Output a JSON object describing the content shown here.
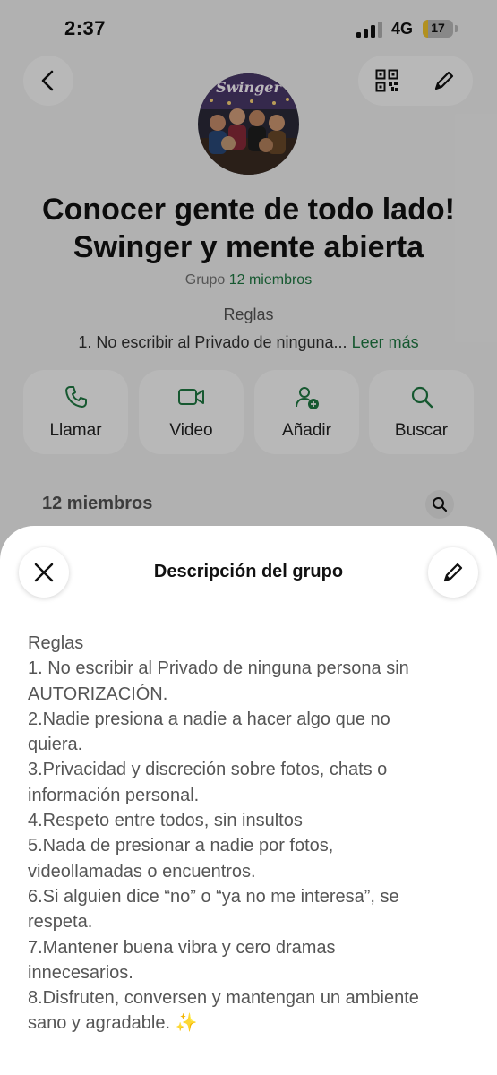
{
  "status_bar": {
    "time": "2:37",
    "network": "4G",
    "battery": "17"
  },
  "header": {
    "back_icon": "chevron-left-icon",
    "qr_icon": "qr-code-icon",
    "edit_icon": "pencil-icon"
  },
  "group": {
    "title_line1": "Conocer gente de todo lado!",
    "title_line2": "Swinger y mente abierta",
    "type_label": "Grupo",
    "members_label": "12 miembros",
    "avatar_text": "Swinger"
  },
  "rules_preview": {
    "heading": "Reglas",
    "text": "1. No escribir al Privado de ninguna...",
    "read_more": "Leer más"
  },
  "actions": [
    {
      "label": "Llamar",
      "icon": "phone-icon"
    },
    {
      "label": "Video",
      "icon": "video-icon"
    },
    {
      "label": "Añadir",
      "icon": "add-person-icon"
    },
    {
      "label": "Buscar",
      "icon": "search-icon"
    }
  ],
  "members_section": {
    "heading": "12 miembros"
  },
  "sheet": {
    "title": "Descripción del grupo",
    "lines": [
      "Reglas",
      "1. No escribir al Privado de ninguna persona sin",
      "AUTORIZACIÓN.",
      "2.Nadie presiona a nadie a hacer algo que no",
      "quiera.",
      "3.Privacidad y discreción sobre fotos, chats o",
      "información personal.",
      "4.Respeto entre todos, sin insultos",
      "5.Nada de presionar a nadie por fotos,",
      "videollamadas o encuentros.",
      "6.Si alguien dice “no” o “ya no me interesa”, se",
      "respeta.",
      "7.Mantener buena vibra y cero dramas",
      "innecesarios.",
      "8.Disfruten, conversen y mantengan un ambiente",
      "sano y agradable. ✨"
    ]
  },
  "colors": {
    "accent": "#1f7a43",
    "battery": "#f7c92b"
  }
}
